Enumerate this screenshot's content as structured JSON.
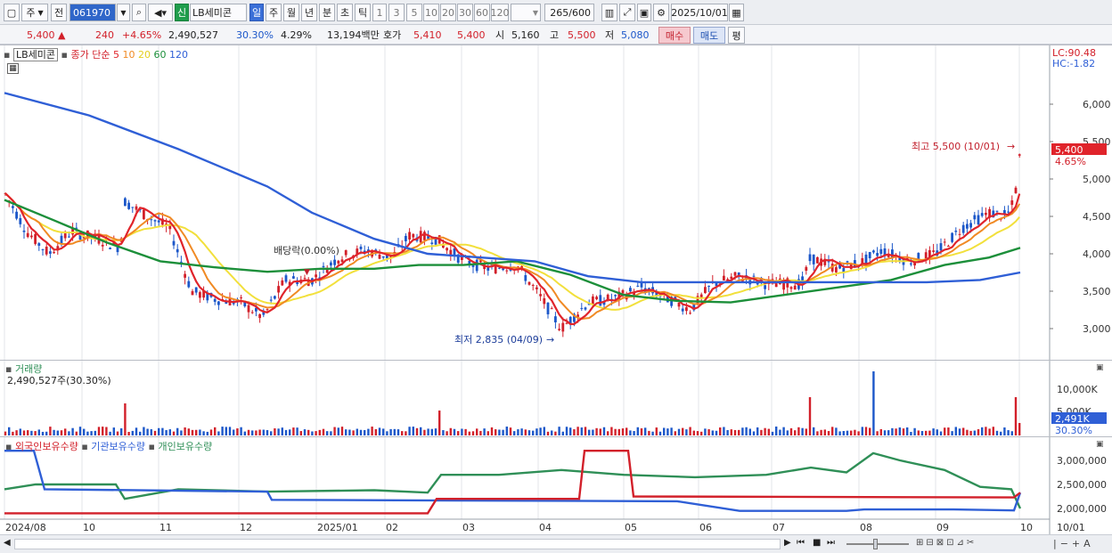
{
  "toolbar": {
    "period_label": "주",
    "prev_label": "전",
    "stock_code": "061970",
    "new_badge": "신",
    "stock_name": "LB세미콘",
    "period_tabs": [
      "일",
      "주",
      "월",
      "년",
      "분",
      "초",
      "틱"
    ],
    "active_tab": "일",
    "interval_buttons": [
      "1",
      "3",
      "5",
      "10",
      "20",
      "30",
      "60",
      "120"
    ],
    "count_display": "265/600",
    "date_value": "2025/10/01"
  },
  "infobar": {
    "price": "5,400",
    "change_arrow": "▲",
    "change": "240",
    "change_pct": "+4.65%",
    "volume": "2,490,527",
    "volume_ratio": "30.30%",
    "turnover": "4.29%",
    "amount": "13,194백만",
    "ask_label": "호가",
    "ask_value": "5,410",
    "bid_value": "5,400",
    "open_label": "시",
    "open_value": "5,160",
    "high_label": "고",
    "high_value": "5,500",
    "low_label": "저",
    "low_value": "5,080",
    "buy_label": "매수",
    "sell_label": "매도",
    "eval_label": "평"
  },
  "price_panel": {
    "name_tag": "LB세미콘",
    "legend_main": "종가 단순",
    "legend_ma": [
      {
        "label": "5",
        "color": "#e0242b"
      },
      {
        "label": "10",
        "color": "#f08a24"
      },
      {
        "label": "20",
        "color": "#f2e03c"
      },
      {
        "label": "60",
        "color": "#1c8f3a"
      },
      {
        "label": "120",
        "color": "#2f5fd6"
      }
    ],
    "lc_label": "LC:90.48",
    "hc_label": "HC:-1.82",
    "current_price_tag": "5,400",
    "current_pct_tag": "4.65%",
    "high_annotation": "최고 5,500 (10/01)",
    "low_annotation": "최저 2,835 (04/09)",
    "dividend_annotation": "배당락(0.00%)",
    "y_ticks": [
      "6,000",
      "5,500",
      "5,000",
      "4,500",
      "4,000",
      "3,500",
      "3,000"
    ],
    "colors": {
      "ma5": "#e0242b",
      "ma10": "#f08a24",
      "ma20": "#f2e03c",
      "ma60": "#1c8f3a",
      "ma120": "#2f5fd6",
      "up": "#d2202a",
      "down": "#1c57c9"
    }
  },
  "volume_panel": {
    "title": "거래량",
    "subtitle": "2,490,527주(30.30%)",
    "y_ticks": [
      "10,000K",
      "5,000K"
    ],
    "current_tag": "2,491K",
    "ratio_tag": "30.30%"
  },
  "holding_panel": {
    "legend": [
      {
        "label": "외국인보유수량",
        "color": "#d2202a"
      },
      {
        "label": "기관보유수량",
        "color": "#2f5fd6"
      },
      {
        "label": "개인보유수량",
        "color": "#2f8f57"
      }
    ],
    "y_ticks": [
      "3,000,000",
      "2,500,000",
      "2,000,000"
    ]
  },
  "x_axis": [
    "2024/08",
    "10",
    "11",
    "12",
    "2025/01",
    "02",
    "03",
    "04",
    "05",
    "06",
    "07",
    "08",
    "09",
    "10",
    "10/01"
  ]
}
